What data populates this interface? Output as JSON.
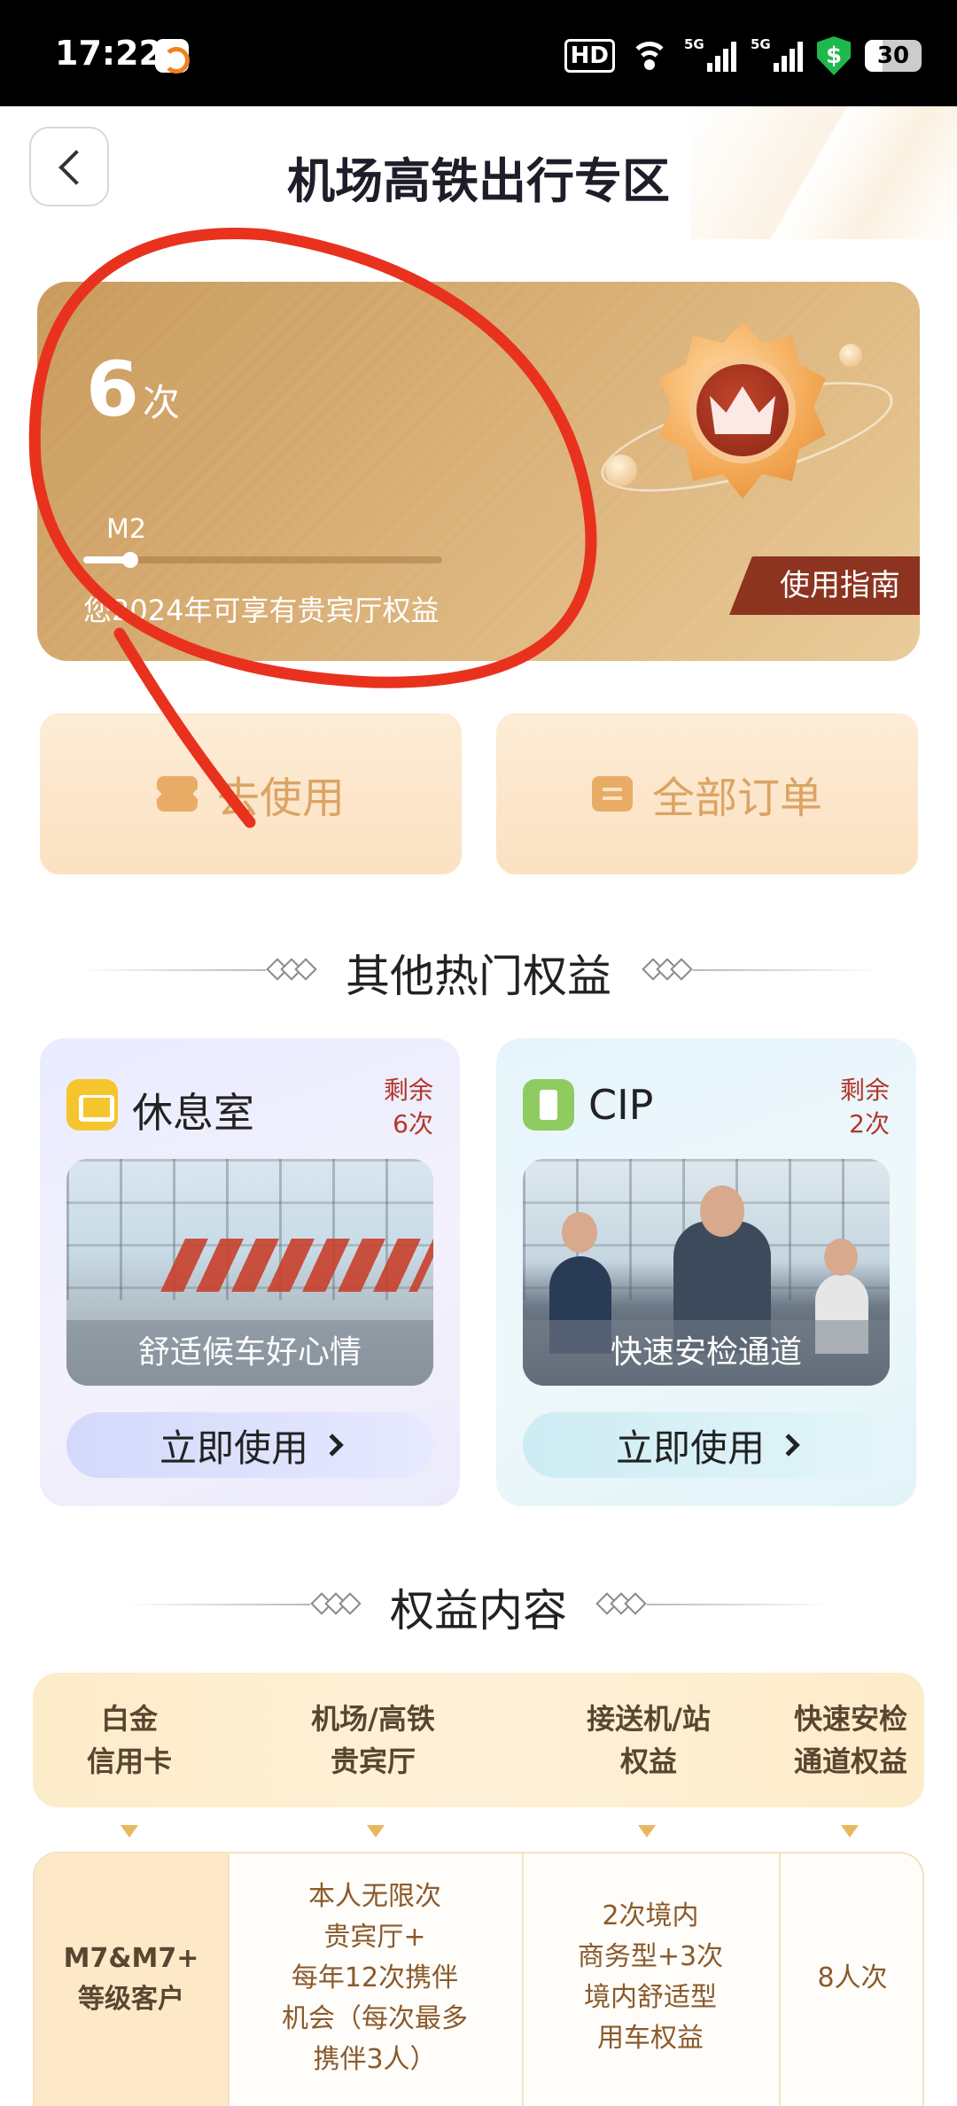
{
  "status_bar": {
    "time": "17:22",
    "hd": "HD",
    "network_1": "5G",
    "network_2": "5G",
    "shield_symbol": "$",
    "battery": "30"
  },
  "header": {
    "title": "机场高铁出行专区",
    "back_icon": "chevron-left-icon"
  },
  "membership_card": {
    "count": "6",
    "count_unit": "次",
    "level": "M2",
    "progress": 0.13,
    "description": "您2024年可享有贵宾厅权益",
    "guide_label": "使用指南",
    "badge_icon": "crown-badge-icon"
  },
  "actions": {
    "use_label": "去使用",
    "orders_label": "全部订单"
  },
  "hot_benefits": {
    "title": "其他热门权益",
    "cards": [
      {
        "name": "休息室",
        "remain_1": "剩余",
        "remain_2": "6次",
        "caption": "舒适候车好心情",
        "button": "立即使用"
      },
      {
        "name": "CIP",
        "remain_1": "剩余",
        "remain_2": "2次",
        "caption": "快速安检通道",
        "button": "立即使用"
      }
    ]
  },
  "rights": {
    "title": "权益内容",
    "headers": [
      [
        "白金",
        "信用卡"
      ],
      [
        "机场/高铁",
        "贵宾厅"
      ],
      [
        "接送机/站",
        "权益"
      ],
      [
        "快速安检",
        "通道权益"
      ]
    ],
    "row": [
      [
        "M7&M7+",
        "等级客户"
      ],
      [
        "本人无限次",
        "贵宾厅+",
        "每年12次携伴",
        "机会（每次最多",
        "携伴3人）"
      ],
      [
        "2次境内",
        "商务型+3次",
        "境内舒适型",
        "用车权益"
      ],
      [
        "8人次"
      ]
    ]
  },
  "colors": {
    "card_gold": "#d8ae74",
    "annotation_red": "#e8321e",
    "accent_brown": "#8c3420"
  }
}
